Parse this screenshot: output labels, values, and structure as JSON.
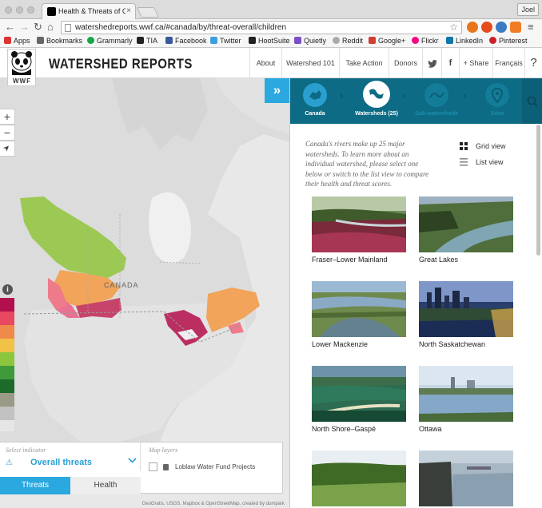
{
  "browser": {
    "tab_title": "Health & Threats of Canada",
    "tab_close": "×",
    "user_name": "Joel",
    "url": "watershedreports.wwf.ca/#canada/by/threat-overall/children",
    "bookmarks": [
      "Apps",
      "Bookmarks",
      "Grammarly",
      "TIA",
      "Facebook",
      "Twitter",
      "HootSuite",
      "Quietly",
      "Reddit",
      "Google+",
      "Flickr",
      "LinkedIn",
      "Pinterest"
    ]
  },
  "header": {
    "logo_text": "WWF",
    "site_title": "WATERSHED REPORTS",
    "nav": [
      "About",
      "Watershed 101",
      "Take Action",
      "Donors"
    ],
    "share": "Share",
    "language": "Français",
    "help": "?"
  },
  "map": {
    "country_label": "CANADA",
    "zoom_in": "+",
    "zoom_out": "−",
    "locate": "➤",
    "legend_info": "i",
    "legend_colors": [
      "#b3104e",
      "#e84860",
      "#f08a4a",
      "#f2c148",
      "#8cc63f",
      "#3f9b3a",
      "#1c6b2a",
      "#9b9a88",
      "#c2c2c2",
      "#e6e6e6"
    ],
    "indicator_label": "Select indicator",
    "indicator_value": "Overall threats",
    "tabs": [
      "Threats",
      "Health"
    ],
    "layers_label": "Map layers",
    "layer_item": "Loblaw Water Fund Projects",
    "attribution": "GeoGratis, USGS, Mapbox & OpenStreetMap, created by dumpark"
  },
  "panel": {
    "toggle": "»",
    "steps": [
      "Canada",
      "Watersheds (25)",
      "Sub-watersheds",
      "Sites"
    ],
    "intro": "Canada's rivers make up 25 major watersheds. To learn more about an individual watershed, please select one below or switch to the list view to compare their health and threat scores.",
    "grid_view": "Grid view",
    "list_view": "List view",
    "watersheds": [
      "Fraser–Lower Mainland",
      "Great Lakes",
      "Lower Mackenzie",
      "North Saskatchewan",
      "North Shore–Gaspé",
      "Ottawa",
      "",
      ""
    ]
  },
  "colors": {
    "accent": "#2ba8e0",
    "step_bar": "#0d6b85",
    "active_step": "#ffffff"
  }
}
